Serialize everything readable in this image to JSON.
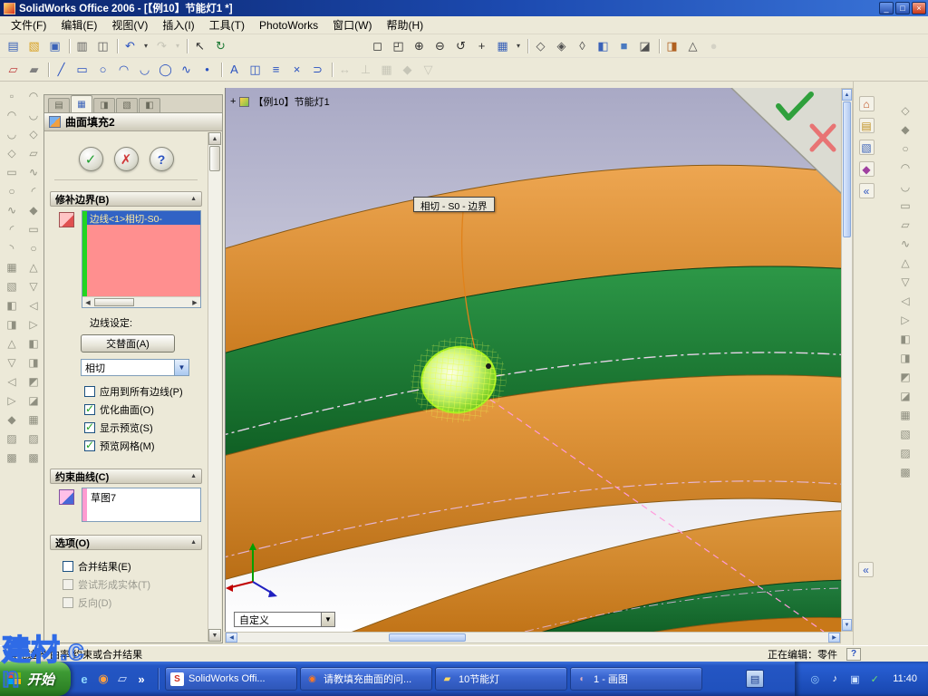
{
  "window": {
    "title": "SolidWorks Office 2006 - [【例10】节能灯1 *]",
    "controls": {
      "minimize": "_",
      "maximize": "□",
      "close": "×"
    }
  },
  "menu": {
    "items": [
      "文件(F)",
      "编辑(E)",
      "视图(V)",
      "插入(I)",
      "工具(T)",
      "PhotoWorks",
      "窗口(W)",
      "帮助(H)"
    ]
  },
  "toolbar_main": {
    "icons": [
      {
        "name": "new-icon",
        "glyph": "▤",
        "color": "#3a62b8"
      },
      {
        "name": "open-icon",
        "glyph": "▧",
        "color": "#d8a020"
      },
      {
        "name": "save-icon",
        "glyph": "▣",
        "color": "#3a62b8"
      },
      {
        "name": "toolbar-separator",
        "glyph": "",
        "cls": "sep",
        "ia": "false"
      },
      {
        "name": "print-icon",
        "glyph": "▥",
        "color": "#606060"
      },
      {
        "name": "print-preview-icon",
        "glyph": "◫",
        "color": "#606060"
      },
      {
        "name": "toolbar-separator",
        "glyph": "",
        "cls": "sep",
        "ia": "false"
      },
      {
        "name": "undo-icon",
        "glyph": "↶",
        "color": "#2a52c0"
      },
      {
        "name": "undo-arrow-icon",
        "glyph": "▾",
        "color": "#404040",
        "cls": "narrow"
      },
      {
        "name": "redo-icon",
        "glyph": "↷",
        "color": "#9a9a90",
        "cls": "dim"
      },
      {
        "name": "redo-arrow-icon",
        "glyph": "▾",
        "color": "#9a9a90",
        "cls": "narrow dim"
      },
      {
        "name": "toolbar-separator",
        "glyph": "",
        "cls": "sep",
        "ia": "false"
      },
      {
        "name": "select-icon",
        "glyph": "↖",
        "color": "#303030"
      },
      {
        "name": "rebuild-icon",
        "glyph": "↻",
        "color": "#1f7a36"
      },
      {
        "name": "toolbar-spacer",
        "glyph": "",
        "cls": "gap",
        "ia": "false"
      },
      {
        "name": "zoom-fit-icon",
        "glyph": "◻",
        "color": "#303030"
      },
      {
        "name": "zoom-area-icon",
        "glyph": "◰",
        "color": "#303030"
      },
      {
        "name": "zoom-in-icon",
        "glyph": "⊕",
        "color": "#303030"
      },
      {
        "name": "zoom-out-icon",
        "glyph": "⊖",
        "color": "#303030"
      },
      {
        "name": "rotate-view-icon",
        "glyph": "↺",
        "color": "#303030"
      },
      {
        "name": "pan-icon",
        "glyph": "+",
        "color": "#303030"
      },
      {
        "name": "standard-views-icon",
        "glyph": "▦",
        "color": "#3a62b8"
      },
      {
        "name": "views-arrow-icon",
        "glyph": "▾",
        "color": "#404040",
        "cls": "narrow"
      },
      {
        "name": "toolbar-separator",
        "glyph": "",
        "cls": "sep",
        "ia": "false"
      },
      {
        "name": "wireframe-icon",
        "glyph": "◇",
        "color": "#505050"
      },
      {
        "name": "hidden-lines-visible-icon",
        "glyph": "◈",
        "color": "#505050"
      },
      {
        "name": "hidden-lines-removed-icon",
        "glyph": "◊",
        "color": "#505050"
      },
      {
        "name": "shaded-with-edges-icon",
        "glyph": "◧",
        "color": "#3a62b8"
      },
      {
        "name": "shaded-icon",
        "glyph": "■",
        "color": "#4a7ac0"
      },
      {
        "name": "shadow-icon",
        "glyph": "◪",
        "color": "#505050"
      },
      {
        "name": "toolbar-separator",
        "glyph": "",
        "cls": "sep",
        "ia": "false"
      },
      {
        "name": "section-view-icon",
        "glyph": "◨",
        "color": "#b06020"
      },
      {
        "name": "camera-view-icon",
        "glyph": "△",
        "color": "#505050"
      },
      {
        "name": "disabled-tool-icon",
        "glyph": "●",
        "color": "#b8b8b0",
        "cls": "dim"
      }
    ]
  },
  "toolbar_sketch": {
    "icons": [
      {
        "name": "sketch-icon",
        "glyph": "▱",
        "color": "#c04040"
      },
      {
        "name": "3d-sketch-icon",
        "glyph": "▰",
        "color": "#808080"
      },
      {
        "name": "toolbar-separator",
        "glyph": "",
        "cls": "sep",
        "ia": "false"
      },
      {
        "name": "line-icon",
        "glyph": "╱",
        "color": "#2a52c0"
      },
      {
        "name": "rectangle-icon",
        "glyph": "▭",
        "color": "#2a52c0"
      },
      {
        "name": "circle-icon",
        "glyph": "○",
        "color": "#2a52c0"
      },
      {
        "name": "arc-icon",
        "glyph": "◠",
        "color": "#2a52c0"
      },
      {
        "name": "tangent-arc-icon",
        "glyph": "◡",
        "color": "#2a52c0"
      },
      {
        "name": "ellipse-icon",
        "glyph": "◯",
        "color": "#2a52c0"
      },
      {
        "name": "spline-icon",
        "glyph": "∿",
        "color": "#2a52c0"
      },
      {
        "name": "point-icon",
        "glyph": "•",
        "color": "#2a52c0"
      },
      {
        "name": "toolbar-separator",
        "glyph": "",
        "cls": "sep",
        "ia": "false"
      },
      {
        "name": "text-icon",
        "glyph": "A",
        "color": "#2a52c0"
      },
      {
        "name": "mirror-icon",
        "glyph": "◫",
        "color": "#2a52c0"
      },
      {
        "name": "offset-icon",
        "glyph": "≡",
        "color": "#2a52c0"
      },
      {
        "name": "trim-icon",
        "glyph": "×",
        "color": "#2a52c0"
      },
      {
        "name": "convert-entities-icon",
        "glyph": "⊃",
        "color": "#2a52c0"
      },
      {
        "name": "toolbar-separator",
        "glyph": "",
        "cls": "sep",
        "ia": "false"
      },
      {
        "name": "dimension-icon",
        "glyph": "↔",
        "color": "#9a9a90",
        "cls": "dim"
      },
      {
        "name": "relations-icon",
        "glyph": "⊥",
        "color": "#9a9a90",
        "cls": "dim"
      },
      {
        "name": "grid-icon",
        "glyph": "▦",
        "color": "#9a9a90",
        "cls": "dim"
      },
      {
        "name": "snap-icon",
        "glyph": "◆",
        "color": "#9a9a90",
        "cls": "dim"
      },
      {
        "name": "quick-snaps-icon",
        "glyph": "▽",
        "color": "#9a9a90",
        "cls": "dim"
      }
    ]
  },
  "left_toolbar": {
    "col1": [
      "▫",
      "◠",
      "◡",
      "◇",
      "▭",
      "○",
      "∿",
      "◜",
      "◝",
      "▦",
      "▧",
      "◧",
      "◨",
      "△",
      "▽",
      "◁",
      "▷",
      "◆",
      "▨",
      "▩"
    ],
    "col2": [
      "◠",
      "◡",
      "◇",
      "▱",
      "∿",
      "◜",
      "◆",
      "▭",
      "○",
      "△",
      "▽",
      "◁",
      "▷",
      "◧",
      "◨",
      "◩",
      "◪",
      "▦",
      "▨",
      "▩"
    ]
  },
  "panel": {
    "tabs": [
      {
        "name": "tab-featuremanager",
        "glyph": "▤",
        "cls": ""
      },
      {
        "name": "tab-propertymanager",
        "glyph": "▦",
        "cls": "active"
      },
      {
        "name": "tab-configurationmanager",
        "glyph": "◨",
        "cls": ""
      },
      {
        "name": "tab-dimxpertmanager",
        "glyph": "▧",
        "cls": ""
      },
      {
        "name": "tab-displaymanager",
        "glyph": "◧",
        "cls": ""
      }
    ],
    "title": "曲面填充2",
    "actions": {
      "ok": "✓",
      "cancel": "✗",
      "help": "?"
    },
    "patch_boundary": {
      "label": "修补边界(B)",
      "selected_edge": "边线<1>相切-S0-",
      "edge_settings_label": "边线设定:",
      "alternate_face_button": "交替面(A)",
      "curvature_control": "相切",
      "checkboxes": [
        {
          "name": "checkbox-apply-to-all-edges",
          "label": "应用到所有边线(P)",
          "cls": "off"
        },
        {
          "name": "checkbox-optimize-surface",
          "label": "优化曲面(O)",
          "cls": "on"
        },
        {
          "name": "checkbox-show-preview",
          "label": "显示预览(S)",
          "cls": "on"
        },
        {
          "name": "checkbox-preview-mesh",
          "label": "预览网格(M)",
          "cls": "on"
        }
      ]
    },
    "constraint_curves": {
      "label": "约束曲线(C)",
      "item": "草图7"
    },
    "options": {
      "label": "选项(O)",
      "checkboxes": [
        {
          "name": "checkbox-merge-result",
          "label": "合并结果(E)",
          "cls": "off"
        },
        {
          "name": "checkbox-try-form-solid",
          "label": "尝试形成实体(T)",
          "cls": "off disabled"
        },
        {
          "name": "checkbox-reverse",
          "label": "反向(D)",
          "cls": "off disabled"
        }
      ]
    }
  },
  "viewport": {
    "tree_prefix": "+",
    "doc_label": "【例10】节能灯1",
    "tooltip": "相切 - S0 - 边界",
    "view_selector": "自定义"
  },
  "right_pane": {
    "pane_icons": [
      {
        "name": "resources-home-icon",
        "glyph": "⌂",
        "color": "#c05020"
      },
      {
        "name": "design-library-icon",
        "glyph": "▤",
        "color": "#c09020"
      },
      {
        "name": "file-explorer-icon",
        "glyph": "▧",
        "color": "#3a62b8"
      },
      {
        "name": "photoworks-items-icon",
        "glyph": "◆",
        "color": "#a040a0"
      },
      {
        "name": "collapse-pane-icon",
        "glyph": "«",
        "color": "#2a52c0"
      }
    ],
    "collapse": "«",
    "tool_icons": [
      "◇",
      "◆",
      "○",
      "◠",
      "◡",
      "▭",
      "▱",
      "∿",
      "△",
      "▽",
      "◁",
      "▷",
      "◧",
      "◨",
      "◩",
      "◪",
      "▦",
      "▧",
      "▨",
      "▩"
    ]
  },
  "status_bar": {
    "left": "填充边界  曲率  约束或合并结果",
    "right": "正在编辑：零件",
    "help": "?"
  },
  "taskbar": {
    "start": "开始",
    "quick_launch": [
      {
        "name": "ie-icon",
        "glyph": "e",
        "fg": "#8fd8ff"
      },
      {
        "name": "browser2-icon",
        "glyph": "◉",
        "fg": "#ffa040"
      },
      {
        "name": "show-desktop-icon",
        "glyph": "▱",
        "fg": "#cfe0ff"
      },
      {
        "name": "quick-launch-more-icon",
        "glyph": "»",
        "fg": "#ffffff"
      }
    ],
    "tasks": [
      {
        "name": "taskbar-task-solidworks",
        "label": "SolidWorks Offi...",
        "glyph": "S",
        "fg": "#d03020",
        "bg": "#ffffff"
      },
      {
        "name": "taskbar-task-browser",
        "label": "请教填充曲面的问...",
        "glyph": "◉",
        "fg": "#ff7820",
        "bg": "transparent"
      },
      {
        "name": "taskbar-task-folder",
        "label": "10节能灯",
        "glyph": "▰",
        "fg": "#ffd860",
        "bg": "transparent"
      },
      {
        "name": "taskbar-task-paint",
        "label": "1 - 画图",
        "glyph": "◐",
        "fg": "#e0b0c0",
        "bg": "transparent"
      }
    ],
    "language_indicator": "▤",
    "tray_icons": [
      {
        "name": "tray-app-icon",
        "glyph": "◎",
        "fg": "#9cd0ff"
      },
      {
        "name": "tray-volume-icon",
        "glyph": "♪",
        "fg": "#ffffff"
      },
      {
        "name": "tray-network-icon",
        "glyph": "▣",
        "fg": "#cfe4ff"
      },
      {
        "name": "tray-security-icon",
        "glyph": "✓",
        "fg": "#70e070"
      }
    ],
    "time": "11:40"
  },
  "watermark": {
    "text": "建材.cn"
  }
}
